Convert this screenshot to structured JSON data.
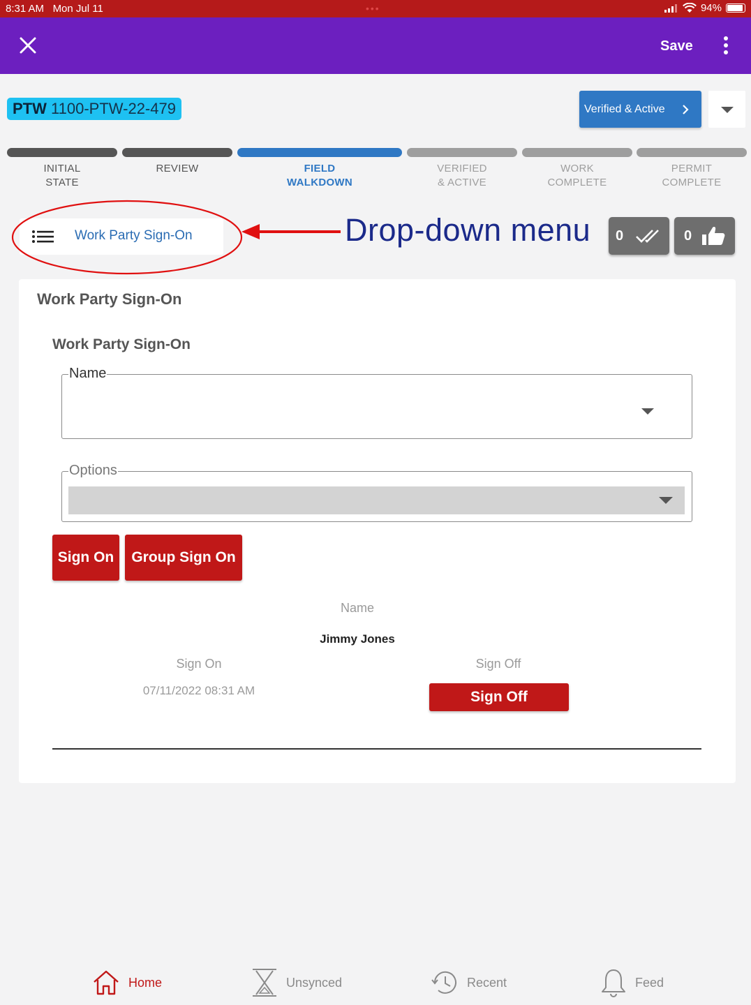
{
  "status_bar": {
    "time": "8:31 AM",
    "date": "Mon Jul 11",
    "battery": "94%"
  },
  "appbar": {
    "save_label": "Save"
  },
  "permit": {
    "prefix": "PTW",
    "number": "1100-PTW-22-479"
  },
  "status_button": {
    "label": "Verified & Active"
  },
  "steps": [
    {
      "label": "INITIAL\nSTATE",
      "state": "done"
    },
    {
      "label": "REVIEW",
      "state": "done"
    },
    {
      "label": "FIELD\nWALKDOWN",
      "state": "current"
    },
    {
      "label": "VERIFIED\n& ACTIVE",
      "state": "pending"
    },
    {
      "label": "WORK\nCOMPLETE",
      "state": "pending"
    },
    {
      "label": "PERMIT\nCOMPLETE",
      "state": "pending"
    }
  ],
  "section_dropdown": {
    "label": "Work Party Sign-On"
  },
  "annotation": {
    "text": "Drop-down menu"
  },
  "counters": {
    "verify_count": "0",
    "like_count": "0"
  },
  "card": {
    "title": "Work Party Sign-On",
    "subtitle": "Work Party Sign-On",
    "name_field": {
      "legend": "Name",
      "value": ""
    },
    "options_field": {
      "legend": "Options",
      "value": ""
    },
    "sign_on_label": "Sign On",
    "group_sign_on_label": "Group Sign On",
    "table": {
      "name_header": "Name",
      "name_value": "Jimmy Jones",
      "sign_on_header": "Sign On",
      "sign_on_value": "07/11/2022 08:31 AM",
      "sign_off_header": "Sign Off",
      "sign_off_button": "Sign Off"
    }
  },
  "colors": {
    "status_bar": "#b51a1a",
    "appbar": "#6c1fbf",
    "accent_blue": "#2f78c4",
    "step_done": "#555555",
    "step_current": "#2f78c4",
    "step_pending": "#9e9e9e",
    "action_red": "#c01818",
    "annotation": "#e01010"
  },
  "bottom_nav": [
    {
      "label": "Home",
      "icon": "home-icon",
      "active": true
    },
    {
      "label": "Unsynced",
      "icon": "hourglass-icon",
      "active": false
    },
    {
      "label": "Recent",
      "icon": "history-icon",
      "active": false
    },
    {
      "label": "Feed",
      "icon": "bell-icon",
      "active": false
    }
  ]
}
